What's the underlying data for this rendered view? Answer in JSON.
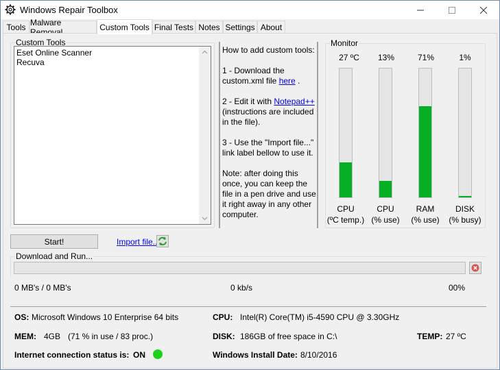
{
  "window": {
    "title": "Windows Repair Toolbox",
    "icon": "gear-icon"
  },
  "tabs": [
    {
      "label": "Tools"
    },
    {
      "label": "Malware Removal"
    },
    {
      "label": "Custom Tools",
      "active": true
    },
    {
      "label": "Final Tests"
    },
    {
      "label": "Notes"
    },
    {
      "label": "Settings"
    },
    {
      "label": "About"
    }
  ],
  "custom_tools": {
    "group_label": "Custom Tools",
    "items": [
      "Eset Online Scanner",
      "Recuva"
    ]
  },
  "instructions": {
    "heading": "How to add custom tools:",
    "step1_line1": "1 - Download the",
    "step1_line2_prefix": "custom.xml file ",
    "step1_link": "here",
    "step1_suffix": " .",
    "step2_prefix": "2 - Edit it with ",
    "step2_link": "Notepad++",
    "step2_line2": "(instructions are included",
    "step2_line3": "in the file).",
    "step3_line1": "3 - Use the \"Import file...\"",
    "step3_line2": "link label bellow to use it.",
    "note_line1": "Note: after doing this",
    "note_line2": "once, you can keep the",
    "note_line3": "file in a pen drive and use",
    "note_line4": "it right away in any other",
    "note_line5": "computer."
  },
  "monitor": {
    "group_label": "Monitor",
    "bar_color": "#06b025",
    "meters": [
      {
        "value": "27 ºC",
        "fill_percent": 27,
        "label1": "CPU",
        "label2": "(ºC temp.)"
      },
      {
        "value": "13%",
        "fill_percent": 13,
        "label1": "CPU",
        "label2": "(% use)"
      },
      {
        "value": "71%",
        "fill_percent": 71,
        "label1": "RAM",
        "label2": "(% use)"
      },
      {
        "value": "1%",
        "fill_percent": 1,
        "label1": "DISK",
        "label2": "(% busy)"
      }
    ]
  },
  "actions": {
    "start_label": "Start!",
    "import_label": "Import file...",
    "refresh_icon": "refresh-icon"
  },
  "download": {
    "group_label": "Download and Run...",
    "progress_percent": 0,
    "size_text": "0 MB's / 0 MB's",
    "speed_text": "0 kb/s",
    "percent_text": "00%",
    "cancel_icon": "close-icon"
  },
  "system": {
    "os_label": "OS:",
    "os_value": "Microsoft Windows 10 Enterprise 64 bits",
    "cpu_label": "CPU:",
    "cpu_value": "Intel(R) Core(TM) i5-4590 CPU @ 3.30GHz",
    "mem_label": "MEM:",
    "mem_value": "4GB",
    "mem_detail": "(71 % in use / 83 proc.)",
    "disk_label": "DISK:",
    "disk_value": "186GB of free space in C:\\",
    "temp_label": "TEMP:",
    "temp_value": "27 ºC",
    "internet_label": "Internet connection status is:",
    "internet_value": "ON",
    "internet_color": "#1ad31a",
    "install_label": "Windows Install Date:",
    "install_value": "8/10/2016"
  }
}
